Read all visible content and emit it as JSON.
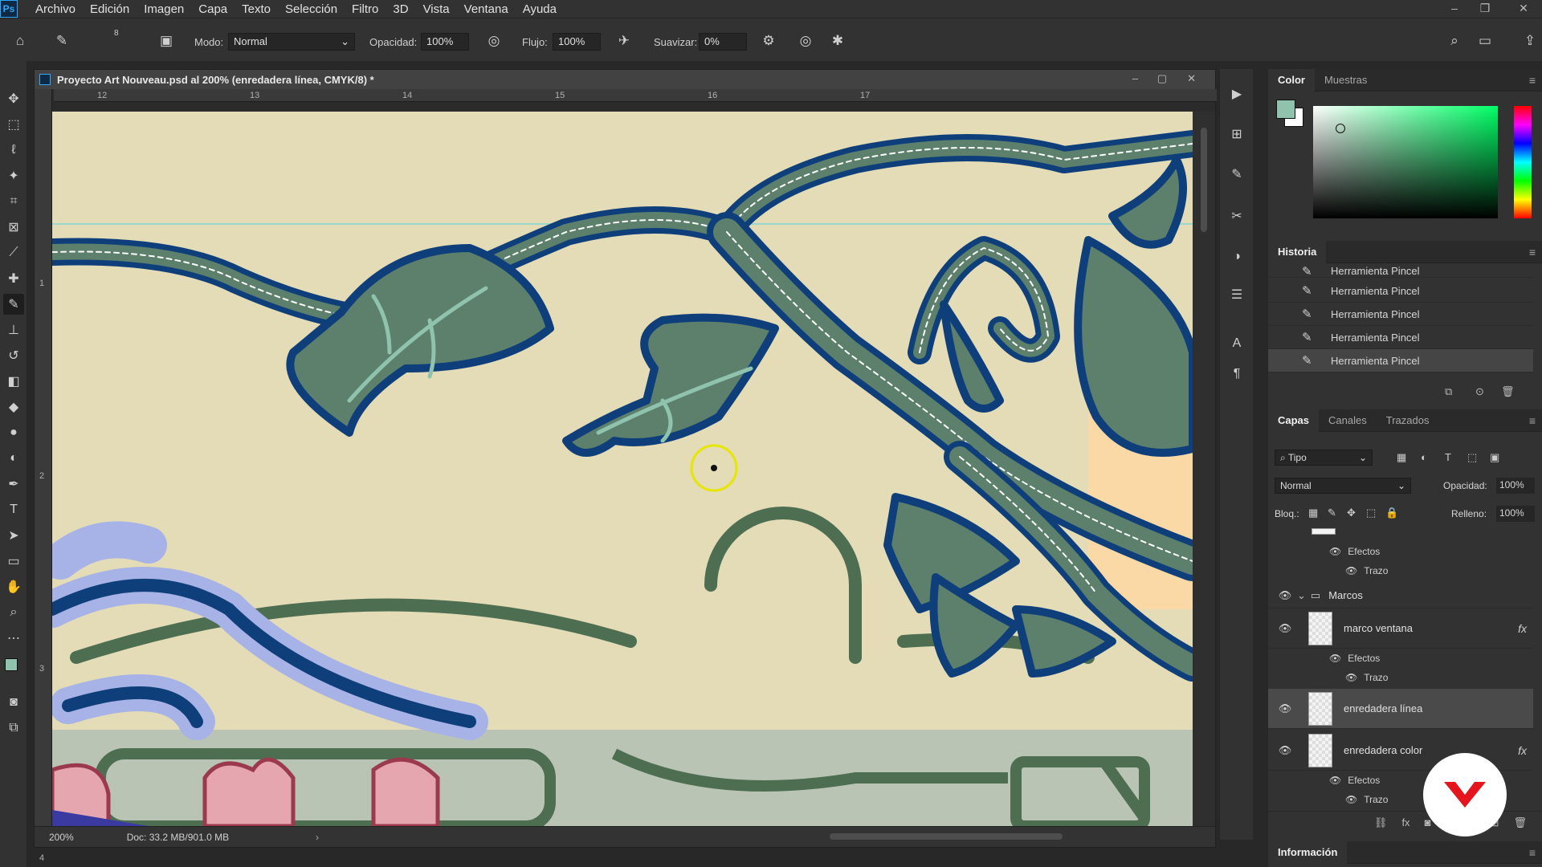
{
  "menubar": {
    "logo": "Ps",
    "items": [
      "Archivo",
      "Edición",
      "Imagen",
      "Capa",
      "Texto",
      "Selección",
      "Filtro",
      "3D",
      "Vista",
      "Ventana",
      "Ayuda"
    ]
  },
  "options": {
    "brush_size": "8",
    "mode_label": "Modo:",
    "mode_value": "Normal",
    "opacity_label": "Opacidad:",
    "opacity_value": "100%",
    "flow_label": "Flujo:",
    "flow_value": "100%",
    "smooth_label": "Suavizar:",
    "smooth_value": "0%"
  },
  "document": {
    "title": "Proyecto Art Nouveau.psd al 200% (enredadera línea, CMYK/8) *",
    "ruler_top": [
      "12",
      "13",
      "14",
      "15",
      "16",
      "17"
    ],
    "ruler_left": [
      "1",
      "2",
      "3",
      "4"
    ],
    "zoom": "200%",
    "doc_info": "Doc: 33.2 MB/901.0 MB"
  },
  "color_panel": {
    "tabs": [
      "Color",
      "Muestras"
    ],
    "foreground": "#8fc3ae",
    "background": "#ffffff"
  },
  "history_panel": {
    "title": "Historia",
    "items": [
      "Herramienta Pincel",
      "Herramienta Pincel",
      "Herramienta Pincel",
      "Herramienta Pincel",
      "Herramienta Pincel"
    ]
  },
  "layers_panel": {
    "tabs": [
      "Capas",
      "Canales",
      "Trazados"
    ],
    "filter_label": "Tipo",
    "blend_mode": "Normal",
    "opacity_label": "Opacidad:",
    "opacity_value": "100%",
    "lock_label": "Bloq.:",
    "fill_label": "Relleno:",
    "fill_value": "100%",
    "effects_label": "Efectos",
    "stroke_label": "Trazo",
    "group_name": "Marcos",
    "layer_marco": "marco ventana",
    "layer_linea": "enredadera línea",
    "layer_color": "enredadera color",
    "fx": "fx"
  },
  "info_panel": {
    "title": "Información"
  }
}
